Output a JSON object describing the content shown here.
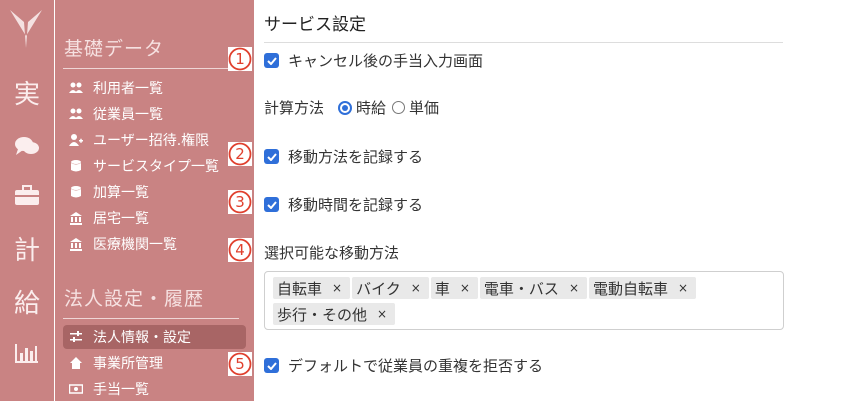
{
  "rail": {
    "items": [
      {
        "label": "実",
        "icon": "calendar-text-icon"
      },
      {
        "label": "",
        "icon": "chat-icon"
      },
      {
        "label": "",
        "icon": "briefcase-icon"
      },
      {
        "label": "計",
        "icon": "text-icon"
      },
      {
        "label": "給",
        "icon": "text-icon"
      },
      {
        "label": "",
        "icon": "bar-chart-icon"
      }
    ]
  },
  "sidebar": {
    "section1": {
      "title": "基礎データ",
      "items": [
        {
          "label": "利用者一覧",
          "icon": "users-icon"
        },
        {
          "label": "従業員一覧",
          "icon": "users-icon"
        },
        {
          "label": "ユーザー招待.権限",
          "icon": "user-plus-icon"
        },
        {
          "label": "サービスタイプ一覧",
          "icon": "database-icon"
        },
        {
          "label": "加算一覧",
          "icon": "database-icon"
        },
        {
          "label": "居宅一覧",
          "icon": "institution-icon"
        },
        {
          "label": "医療機関一覧",
          "icon": "institution-icon"
        }
      ]
    },
    "section2": {
      "title": "法人設定・履歴",
      "items": [
        {
          "label": "法人情報・設定",
          "icon": "sliders-icon",
          "active": true
        },
        {
          "label": "事業所管理",
          "icon": "home-icon"
        },
        {
          "label": "手当一覧",
          "icon": "money-icon"
        }
      ]
    }
  },
  "main": {
    "title": "サービス設定",
    "badges": [
      "①",
      "②",
      "③",
      "④",
      "⑤"
    ],
    "option1": {
      "label": "キャンセル後の手当入力画面",
      "checked": true
    },
    "calc": {
      "label": "計算方法",
      "option_hourly": "時給",
      "option_unit": "単価",
      "selected": "時給"
    },
    "option2": {
      "label": "移動方法を記録する",
      "checked": true
    },
    "option3": {
      "label": "移動時間を記録する",
      "checked": true
    },
    "methods": {
      "label": "選択可能な移動方法",
      "tags": [
        "自転車",
        "バイク",
        "車",
        "電車・バス",
        "電動自転車",
        "歩行・その他"
      ],
      "remove_glyph": "×"
    },
    "option5": {
      "label": "デフォルトで従業員の重複を拒否する",
      "checked": true
    }
  },
  "colors": {
    "sidebar": "#c98383",
    "accent": "#2f6fd9",
    "badge": "#e0402e"
  }
}
